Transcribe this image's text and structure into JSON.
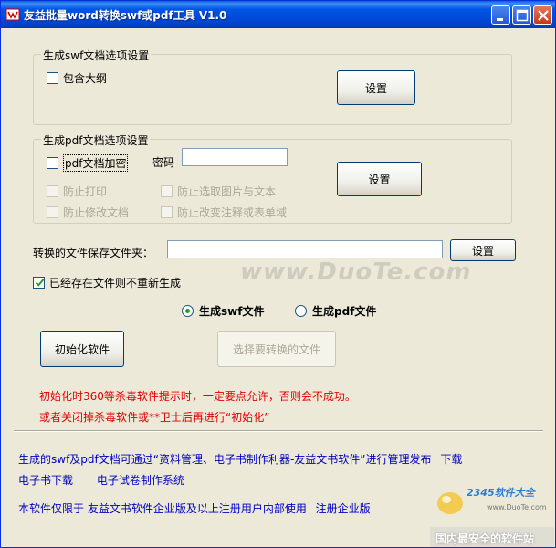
{
  "window": {
    "title": "友益批量word转换swf或pdf工具 V1.0"
  },
  "swf_group": {
    "title": "生成swf文档选项设置",
    "include_outline": "包含大纲",
    "settings_button": "设置"
  },
  "pdf_group": {
    "title": "生成pdf文档选项设置",
    "encrypt": "pdf文档加密",
    "password_label": "密码",
    "password_value": "",
    "no_print": "防止打印",
    "no_copy": "防止选取图片与文本",
    "no_modify": "防止修改文档",
    "no_annot": "防止改变注释或表单域",
    "settings_button": "设置"
  },
  "save_folder": {
    "label": "转换的文件保存文件夹：",
    "value": "",
    "button": "设置"
  },
  "skip_existing": "已经存在文件则不重新生成",
  "output": {
    "swf": "生成swf文件",
    "pdf": "生成pdf文件"
  },
  "buttons": {
    "init": "初始化软件",
    "choose": "选择要转换的文件"
  },
  "warning": {
    "line1": "初始化时360等杀毒软件提示时，一定要点允许，否则会不成功。",
    "line2": "或者关闭掉杀毒软件或**卫士后再进行“初始化”"
  },
  "footer": {
    "line1_text": "生成的swf及pdf文档可通过“资料管理、电子书制作利器-友益文书软件”进行管理发布",
    "download": "下载",
    "ebook_download": "电子书下载",
    "exam_system": "电子试卷制作系统",
    "line3_text": "本软件仅限于 友益文书软件企业版及以上注册用户内部使用",
    "register": "注册企业版"
  },
  "watermark": "www.DuoTe.com",
  "corner_badge": {
    "brand": "2345软件大全",
    "url": "www.DuoTe.com",
    "slogan": "国内最安全的软件站"
  },
  "colors": {
    "titlebar": "#0055e5",
    "warning": "#e00000",
    "link": "#0000c0"
  }
}
